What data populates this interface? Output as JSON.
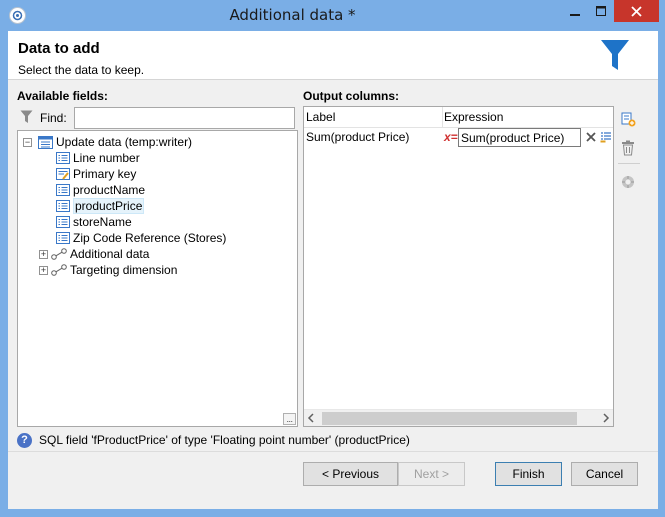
{
  "window": {
    "title": "Additional data *"
  },
  "header": {
    "title": "Data to add",
    "subtitle": "Select the data to keep."
  },
  "left": {
    "heading": "Available fields:",
    "find_label": "Find:",
    "find_value": "",
    "tree": [
      {
        "label": "Update data (temp:writer)",
        "icon": "table-icon",
        "expander": "−"
      },
      {
        "label": "Line number",
        "icon": "field-icon"
      },
      {
        "label": "Primary key",
        "icon": "key-field-icon"
      },
      {
        "label": "productName",
        "icon": "field-icon"
      },
      {
        "label": "productPrice",
        "icon": "field-icon",
        "selected": true
      },
      {
        "label": "storeName",
        "icon": "field-icon"
      },
      {
        "label": "Zip Code Reference (Stores)",
        "icon": "field-icon"
      },
      {
        "label": "Additional data",
        "icon": "link-icon",
        "expander": "+"
      },
      {
        "label": "Targeting dimension",
        "icon": "link-icon",
        "expander": "+"
      }
    ],
    "dots": "..."
  },
  "right": {
    "heading": "Output columns:",
    "columns": [
      "Label",
      "Expression"
    ],
    "rows": [
      {
        "label": "Sum(product Price)",
        "expr_marker": "x=",
        "expression": "Sum(product Price)"
      }
    ]
  },
  "info": {
    "icon": "?",
    "text": "SQL field 'fProductPrice' of type 'Floating point number' (productPrice)"
  },
  "buttons": {
    "previous": "< Previous",
    "next": "Next >",
    "finish": "Finish",
    "cancel": "Cancel"
  },
  "colors": {
    "titlebar": "#7aaee6",
    "close": "#c7352b",
    "funnel": "#1e73c8"
  }
}
